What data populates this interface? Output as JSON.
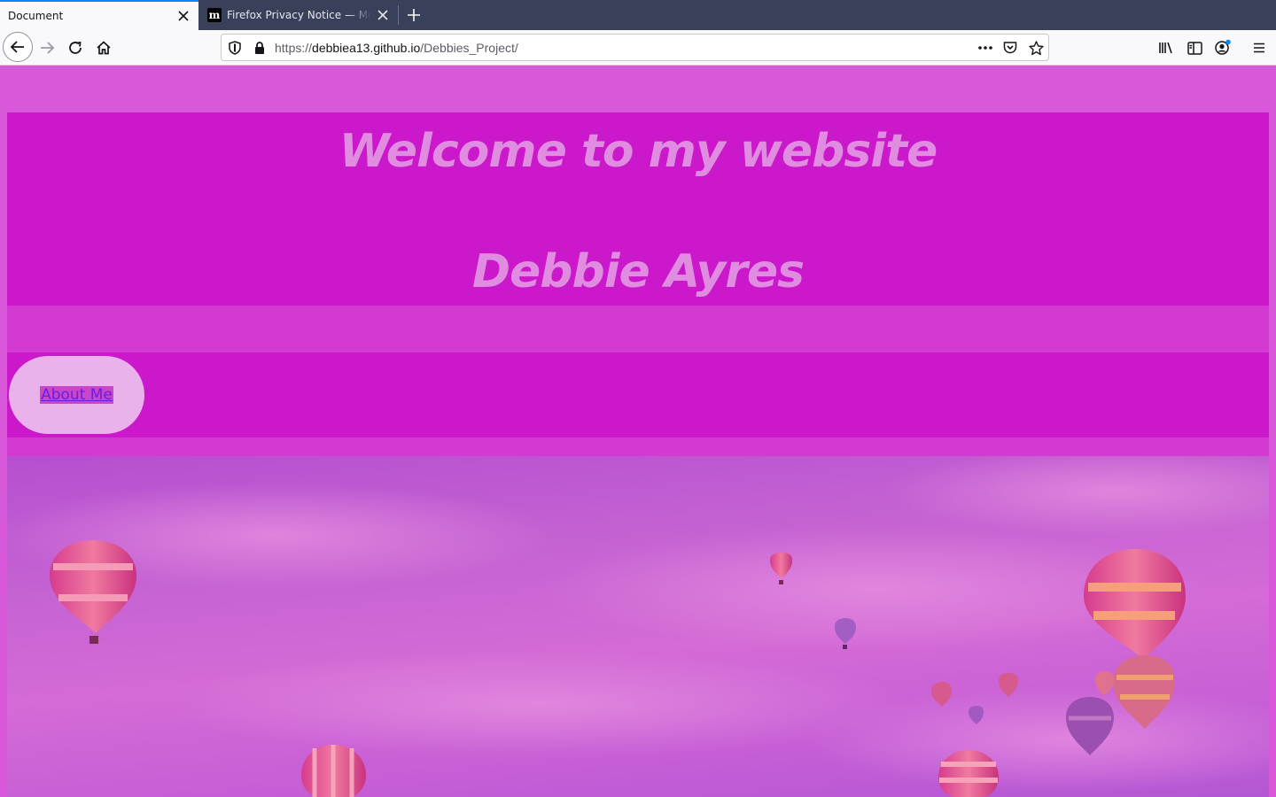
{
  "browser": {
    "tabs": [
      {
        "title": "Document",
        "active": true
      },
      {
        "title": "Firefox Privacy Notice — Mozilla",
        "favicon": "m",
        "active": false
      }
    ],
    "url": {
      "scheme": "https://",
      "host": "debbiea13.github.io",
      "path": "/Debbies_Project/"
    },
    "icons": [
      "back-icon",
      "forward-icon",
      "reload-icon",
      "home-icon",
      "shield-icon",
      "lock-icon",
      "more-icon",
      "pocket-icon",
      "star-icon",
      "library-icon",
      "sidebar-icon",
      "account-icon",
      "menu-icon"
    ]
  },
  "page": {
    "header": {
      "welcome": "Welcome to my website",
      "name": "Debbie Ayres"
    },
    "nav": {
      "about_label": "About Me"
    },
    "hero": {
      "image": "hot-air-balloons-sky"
    },
    "colors": {
      "background": "#d957d9",
      "header": "#ca18ca",
      "title_text": "#e08ce0",
      "button": "#eab2ea",
      "link": "#6a1fe0"
    }
  }
}
